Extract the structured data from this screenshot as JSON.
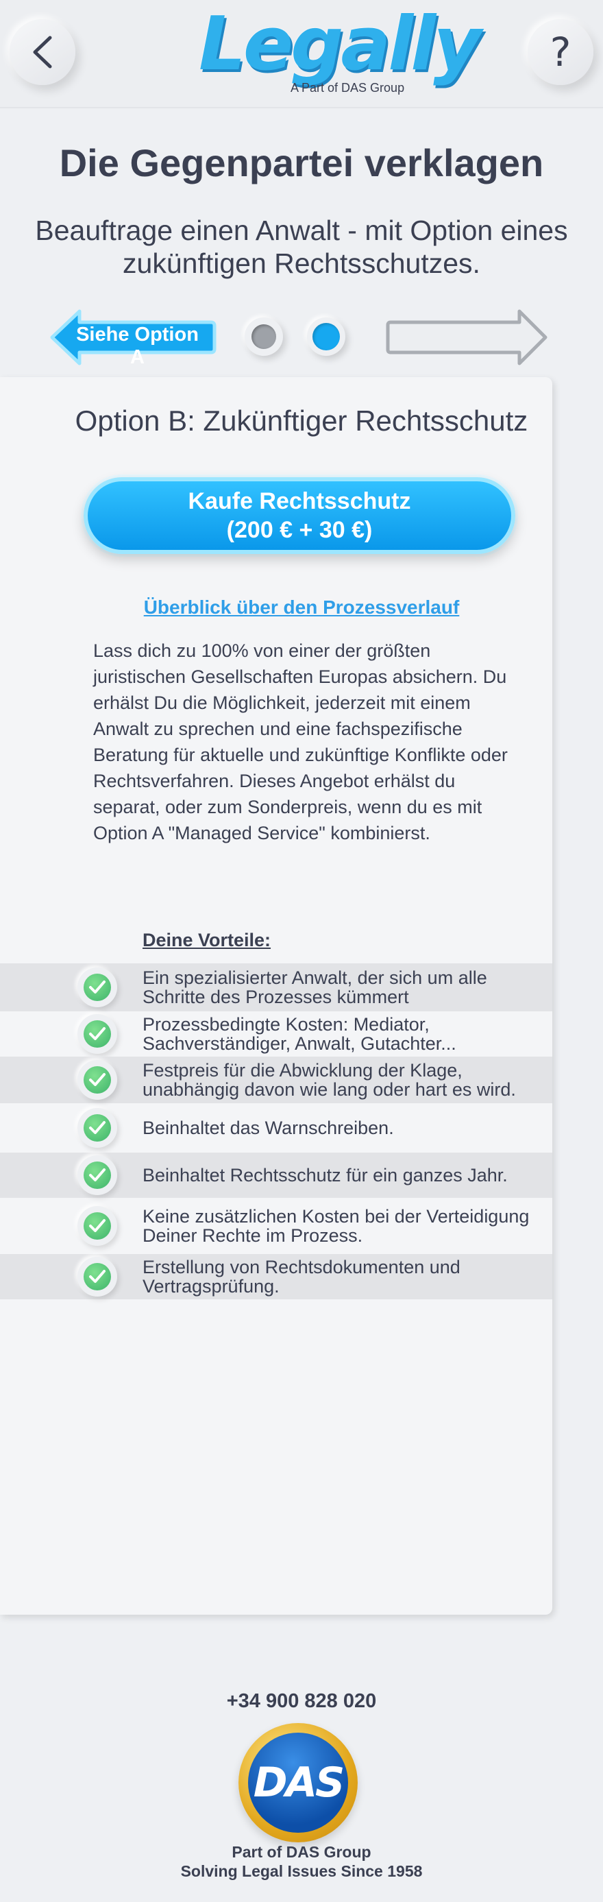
{
  "header": {
    "logo_text": "Legally",
    "logo_subtitle": "A Part of DAS Group",
    "back_icon": "chevron-left-icon",
    "help_icon": "question-icon",
    "back_glyph": "<",
    "help_glyph": "?"
  },
  "page": {
    "title": "Die Gegenpartei verklagen",
    "subtitle": "Beauftrage einen Anwalt - mit Option eines zukünftigen Rechtsschutzes."
  },
  "navigator": {
    "option_a_label": "Siehe Option A",
    "step_count": 2,
    "active_step": 2,
    "accent_color": "#16a8f0"
  },
  "card": {
    "title": "Option B: Zukünftiger Rechtsschutz",
    "buy_button": {
      "line1": "Kaufe Rechtsschutz",
      "line2": "(200 € + 30 €)"
    },
    "overview_link": "Überblick über den Prozessverlauf",
    "description": "Lass dich zu 100% von einer der größten juristischen Gesellschaften Europas absichern. Du erhälst Du die Möglichkeit, jederzeit mit einem Anwalt zu sprechen und eine fachspezifische Beratung  für aktuelle und zukünftige Konflikte oder Rechtsverfahren. Dieses Angebot erhälst du separat, oder zum Sonderpreis, wenn du es mit  Option A \"Managed Service\" kombinierst.",
    "benefits_heading": "Deine Vorteile:",
    "benefits": [
      "Ein spezialisierter Anwalt, der sich um alle Schritte des Prozesses kümmert",
      "Prozessbedingte Kosten: Mediator, Sachverständiger, Anwalt, Gutachter...",
      "Festpreis für die Abwicklung der Klage, unabhängig davon wie lang oder hart es wird.",
      "Beinhaltet das Warnschreiben.",
      "Beinhaltet Rechtsschutz für ein ganzes Jahr.",
      "Keine zusätzlichen Kosten bei der Verteidigung Deiner Rechte im Prozess.",
      "Erstellung von Rechtsdokumenten und Vertragsprüfung."
    ]
  },
  "footer": {
    "phone": "+34 900 828 020",
    "seal_text": "DAS",
    "line1": "Part of DAS Group",
    "line2": "Solving Legal Issues Since 1958"
  }
}
